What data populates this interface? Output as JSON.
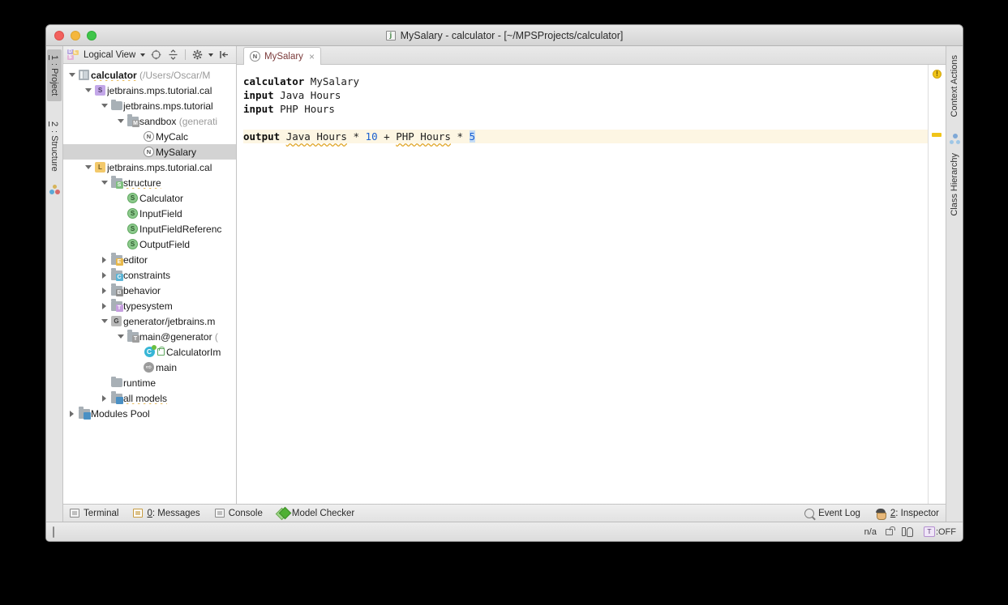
{
  "window": {
    "title": "MySalary - calculator - [~/MPSProjects/calculator]",
    "app_icon": "j",
    "controls": {
      "close": "close-button",
      "minimize": "minimize-button",
      "maximize": "maximize-button"
    }
  },
  "left_tool_tabs": [
    {
      "num": "1",
      "label": ": Project",
      "active": true
    },
    {
      "num": "2",
      "label": ": Structure",
      "active": false
    }
  ],
  "right_tool_tabs": [
    {
      "label": "Context Actions"
    },
    {
      "label": "Class Hierarchy"
    }
  ],
  "project_toolbar": {
    "view_label": "Logical View",
    "icons": [
      "view-mode-badge-icon",
      "chevron-down-icon",
      "scroll-from-source-icon",
      "collapse-all-icon",
      "settings-gear-icon",
      "gear-chevron-icon",
      "hide-panel-icon"
    ]
  },
  "tree": [
    {
      "indent": 0,
      "arrow": "open",
      "icon": "project-icon",
      "label": "calculator",
      "suffix": " (/Users/Oscar/M",
      "bold": true,
      "squiggle": true,
      "selected": false
    },
    {
      "indent": 1,
      "arrow": "open",
      "icon": "solution-icon",
      "label": "jetbrains.mps.tutorial.cal",
      "suffix": "",
      "bold": false,
      "squiggle": false,
      "selected": false
    },
    {
      "indent": 2,
      "arrow": "open",
      "icon": "folder-icon",
      "label": "jetbrains.mps.tutorial",
      "suffix": "",
      "bold": false,
      "squiggle": false,
      "selected": false
    },
    {
      "indent": 3,
      "arrow": "open",
      "icon": "model-icon",
      "label": "sandbox",
      "suffix": " (generati",
      "bold": false,
      "squiggle": false,
      "selected": false
    },
    {
      "indent": 4,
      "arrow": "none",
      "icon": "node-icon",
      "label": "MyCalc",
      "suffix": "",
      "bold": false,
      "squiggle": false,
      "selected": false
    },
    {
      "indent": 4,
      "arrow": "none",
      "icon": "node-icon",
      "label": "MySalary",
      "suffix": "",
      "bold": false,
      "squiggle": false,
      "selected": true
    },
    {
      "indent": 1,
      "arrow": "open",
      "icon": "language-icon",
      "label": "jetbrains.mps.tutorial.cal",
      "suffix": "",
      "bold": false,
      "squiggle": false,
      "selected": false
    },
    {
      "indent": 2,
      "arrow": "open",
      "icon": "structure-icon",
      "label": "structure",
      "suffix": "",
      "bold": false,
      "squiggle": true,
      "selected": false
    },
    {
      "indent": 3,
      "arrow": "none",
      "icon": "concept-icon",
      "label": "Calculator",
      "suffix": "",
      "bold": false,
      "squiggle": false,
      "selected": false
    },
    {
      "indent": 3,
      "arrow": "none",
      "icon": "concept-icon",
      "label": "InputField",
      "suffix": "",
      "bold": false,
      "squiggle": false,
      "selected": false
    },
    {
      "indent": 3,
      "arrow": "none",
      "icon": "concept-icon",
      "label": "InputFieldReferenc",
      "suffix": "",
      "bold": false,
      "squiggle": false,
      "selected": false
    },
    {
      "indent": 3,
      "arrow": "none",
      "icon": "concept-icon",
      "label": "OutputField",
      "suffix": "",
      "bold": false,
      "squiggle": false,
      "selected": false
    },
    {
      "indent": 2,
      "arrow": "closed",
      "icon": "editor-aspect-icon",
      "label": "editor",
      "suffix": "",
      "bold": false,
      "squiggle": false,
      "selected": false
    },
    {
      "indent": 2,
      "arrow": "closed",
      "icon": "constraints-aspect-icon",
      "label": "constraints",
      "suffix": "",
      "bold": false,
      "squiggle": false,
      "selected": false
    },
    {
      "indent": 2,
      "arrow": "closed",
      "icon": "behavior-aspect-icon",
      "label": "behavior",
      "suffix": "",
      "bold": false,
      "squiggle": false,
      "selected": false
    },
    {
      "indent": 2,
      "arrow": "closed",
      "icon": "typesystem-aspect-icon",
      "label": "typesystem",
      "suffix": "",
      "bold": false,
      "squiggle": false,
      "selected": false
    },
    {
      "indent": 2,
      "arrow": "open",
      "icon": "generator-icon",
      "label": "generator/jetbrains.m",
      "suffix": "",
      "bold": false,
      "squiggle": false,
      "selected": false
    },
    {
      "indent": 3,
      "arrow": "open",
      "icon": "template-model-icon",
      "label": "main@generator",
      "suffix": " (",
      "bold": false,
      "squiggle": false,
      "selected": false
    },
    {
      "indent": 4,
      "arrow": "none",
      "icon": "class-icon",
      "label": "CalculatorIm",
      "suffix": "",
      "bold": false,
      "squiggle": false,
      "selected": false
    },
    {
      "indent": 4,
      "arrow": "none",
      "icon": "mapping-icon",
      "label": "main",
      "suffix": "",
      "bold": false,
      "squiggle": false,
      "selected": false
    },
    {
      "indent": 2,
      "arrow": "none",
      "icon": "folder-icon",
      "label": "runtime",
      "suffix": "",
      "bold": false,
      "squiggle": false,
      "selected": false
    },
    {
      "indent": 2,
      "arrow": "closed",
      "icon": "all-models-icon",
      "label": "all models",
      "suffix": "",
      "bold": false,
      "squiggle": true,
      "selected": false
    },
    {
      "indent": 0,
      "arrow": "closed",
      "icon": "modules-pool-icon",
      "label": "Modules Pool",
      "suffix": "",
      "bold": false,
      "squiggle": false,
      "selected": false
    }
  ],
  "editor": {
    "tab": {
      "label": "MySalary",
      "icon": "node-icon",
      "close": "×"
    },
    "lines": [
      {
        "highlight": false,
        "tokens": [
          {
            "text": "calculator",
            "style": "kw"
          },
          {
            "text": " ",
            "style": "op"
          },
          {
            "text": "MySalary",
            "style": "op"
          }
        ]
      },
      {
        "highlight": false,
        "tokens": [
          {
            "text": "input",
            "style": "kw"
          },
          {
            "text": " ",
            "style": "op"
          },
          {
            "text": "Java Hours",
            "style": "op"
          }
        ]
      },
      {
        "highlight": false,
        "tokens": [
          {
            "text": "input",
            "style": "kw"
          },
          {
            "text": " ",
            "style": "op"
          },
          {
            "text": "PHP Hours",
            "style": "op"
          }
        ]
      },
      {
        "highlight": false,
        "tokens": [
          {
            "text": " ",
            "style": "op"
          }
        ]
      },
      {
        "highlight": true,
        "tokens": [
          {
            "text": "output",
            "style": "kw"
          },
          {
            "text": " ",
            "style": "op"
          },
          {
            "text": "Java Hours",
            "style": "ref"
          },
          {
            "text": " ",
            "style": "op"
          },
          {
            "text": "*",
            "style": "op"
          },
          {
            "text": " ",
            "style": "op"
          },
          {
            "text": "10",
            "style": "num"
          },
          {
            "text": " ",
            "style": "op"
          },
          {
            "text": "+",
            "style": "op"
          },
          {
            "text": " ",
            "style": "op"
          },
          {
            "text": "PHP Hours",
            "style": "ref"
          },
          {
            "text": " ",
            "style": "op"
          },
          {
            "text": "*",
            "style": "op"
          },
          {
            "text": " ",
            "style": "op"
          },
          {
            "text": "5",
            "style": "selnum"
          }
        ]
      }
    ],
    "gutter": {
      "warning_glyph": "!",
      "warning_marker": "warning-stripe"
    }
  },
  "tool_window_bar": {
    "left": [
      {
        "label": "Terminal",
        "icon": "terminal-icon",
        "mnemonic": ""
      },
      {
        "label": ": Messages",
        "icon": "messages-icon",
        "mnemonic": "0"
      },
      {
        "label": "Console",
        "icon": "console-icon",
        "mnemonic": ""
      },
      {
        "label": "Model Checker",
        "icon": "model-checker-icon",
        "mnemonic": ""
      }
    ],
    "right": [
      {
        "label": "Event Log",
        "icon": "event-log-icon",
        "mnemonic": ""
      },
      {
        "label": ": Inspector",
        "icon": "inspector-icon",
        "mnemonic": "2"
      }
    ]
  },
  "status_bar": {
    "left_icon": "screen-toggle-icon",
    "memory": "n/a",
    "icons": [
      "lock-icon",
      "power-plug-icon"
    ],
    "tooltip_badge": "T",
    "tooltip_state": ":OFF"
  }
}
